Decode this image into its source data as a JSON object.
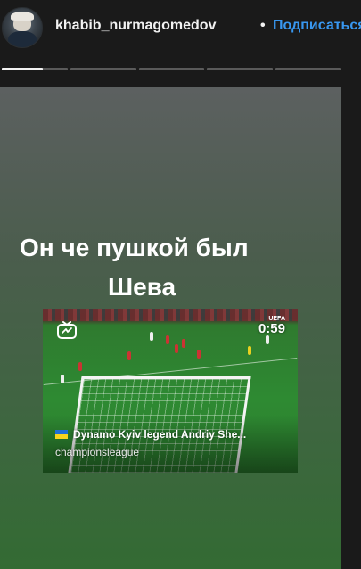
{
  "header": {
    "username": "khabib_nurmagomedov",
    "separator": "•",
    "follow_label": "Подписаться"
  },
  "story": {
    "segments_total": 5,
    "active_segment": 1,
    "active_progress": 0.62,
    "caption_line1": "Он че пушкой был",
    "caption_line2": "Шева",
    "background_top": "#5c6060",
    "background_bottom": "#336b33"
  },
  "igtv_card": {
    "icon": "igtv-icon",
    "duration": "0:59",
    "watermark": "UEFA",
    "title": "Dynamo Kyiv legend Andriy She...",
    "channel": "championsleague",
    "flag_icon": "ukraine-flag-icon"
  },
  "colors": {
    "follow": "#3897f0",
    "text": "#f2f2f2",
    "progress_active": "#f2f2f2",
    "progress_inactive": "#5a5a5a"
  }
}
